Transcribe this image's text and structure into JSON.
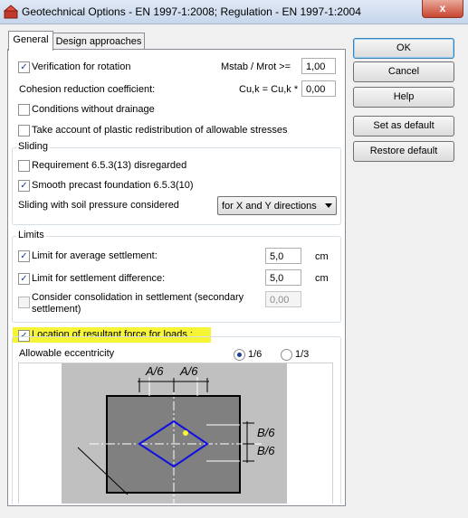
{
  "window": {
    "title": "Geotechnical Options - EN 1997-1:2008;  Regulation - EN 1997-1:2004",
    "close_label": "x"
  },
  "tabs": [
    {
      "label": "General",
      "active": true
    },
    {
      "label": "Design approaches",
      "active": false
    }
  ],
  "general": {
    "verification_rotation": {
      "label": "Verification for rotation",
      "checked": true
    },
    "mstab_label": "Mstab / Mrot  >=",
    "mstab_value": "1,00",
    "cohesion_label": "Cohesion reduction coefficient:",
    "cuk_label": "Cu,k = Cu,k *",
    "cuk_value": "0,00",
    "conditions_drainage": {
      "label": "Conditions without drainage",
      "checked": false
    },
    "plastic_redistribution": {
      "label": "Take account of plastic redistribution of allowable stresses",
      "checked": false
    }
  },
  "sliding": {
    "title": "Sliding",
    "requirement": {
      "label": "Requirement 6.5.3(13) disregarded",
      "checked": false
    },
    "smooth_precast": {
      "label": "Smooth precast foundation 6.5.3(10)",
      "checked": true
    },
    "soil_pressure_label": "Sliding with soil pressure considered",
    "soil_pressure_value": "for X and Y directions"
  },
  "limits": {
    "title": "Limits",
    "average_settlement": {
      "label": "Limit for average settlement:",
      "checked": true,
      "value": "5,0",
      "unit": "cm"
    },
    "settlement_difference": {
      "label": "Limit for settlement difference:",
      "checked": true,
      "value": "5,0",
      "unit": "cm"
    },
    "consolidation": {
      "label_line1": "Consider consolidation in settlement (secondary",
      "label_line2": "settlement)",
      "checked": false,
      "value": "0,00"
    }
  },
  "resultant": {
    "label": "Location of resultant force for loads :",
    "checked": true,
    "eccentricity_label": "Allowable eccentricity",
    "options": [
      {
        "label": "1/6",
        "selected": true
      },
      {
        "label": "1/3",
        "selected": false
      }
    ]
  },
  "figure": {
    "a_label_left": "A/6",
    "a_label_right": "A/6",
    "b_label_top": "B/6",
    "b_label_bottom": "B/6"
  },
  "buttons": {
    "ok": "OK",
    "cancel": "Cancel",
    "help": "Help",
    "set_default": "Set as default",
    "restore_default": "Restore default"
  }
}
